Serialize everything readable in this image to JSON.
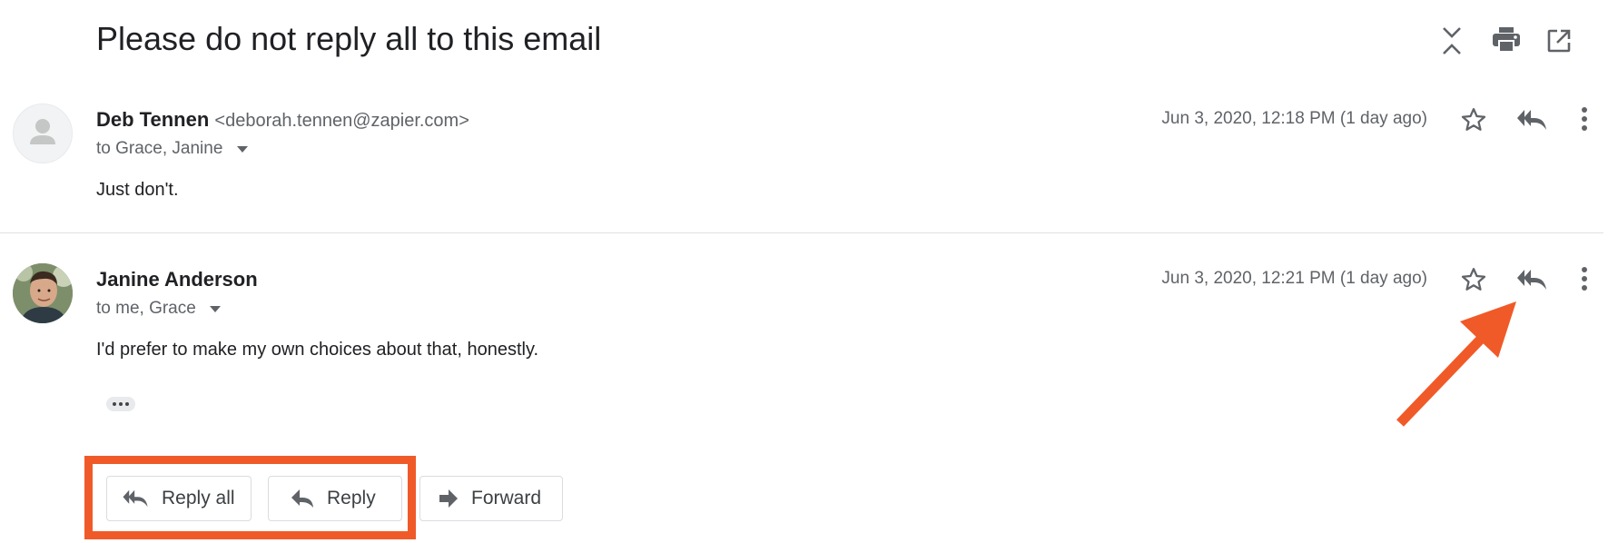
{
  "thread": {
    "subject": "Please do not reply all to this email"
  },
  "toolbar": {
    "icons": [
      "collapse-all-icon",
      "print-icon",
      "open-new-window-icon"
    ]
  },
  "messages": [
    {
      "sender_name": "Deb Tennen",
      "sender_email": "<deborah.tennen@zapier.com>",
      "recipients": "to Grace, Janine",
      "date": "Jun 3, 2020, 12:18 PM (1 day ago)",
      "body": "Just don't.",
      "avatar": "default-person-icon"
    },
    {
      "sender_name": "Janine Anderson",
      "recipients": "to me, Grace",
      "date": "Jun 3, 2020, 12:21 PM (1 day ago)",
      "body": "I'd prefer to make my own choices about that, honestly.",
      "avatar": "profile-photo"
    }
  ],
  "actions": {
    "reply_all_label": "Reply all",
    "reply_label": "Reply",
    "forward_label": "Forward"
  },
  "colors": {
    "annotation": "#f05a28",
    "icon": "#5f6368"
  }
}
